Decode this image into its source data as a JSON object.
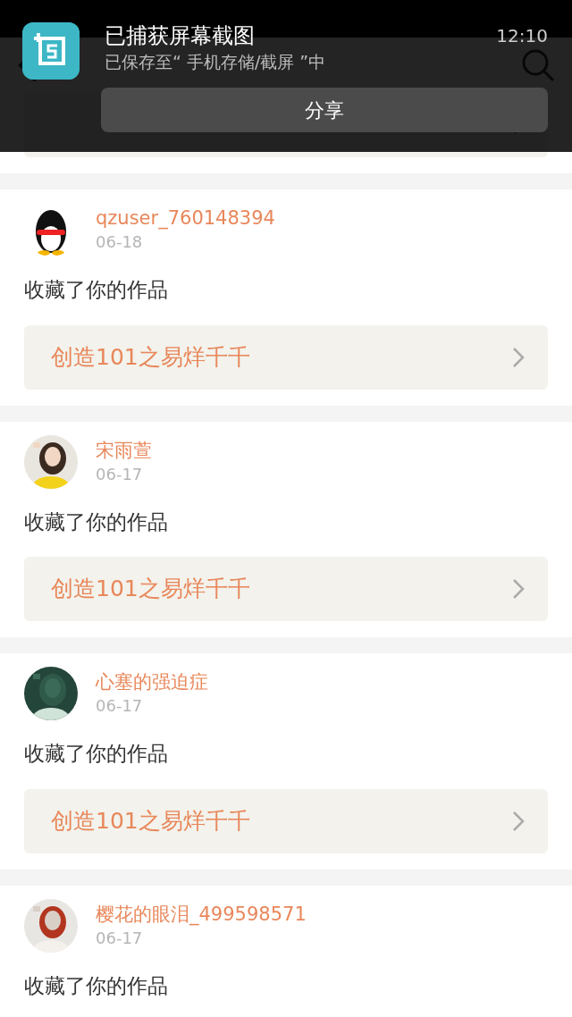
{
  "notification": {
    "title": "已捕获屏幕截图",
    "subtitle": "已保存至“ 手机存储/截屏 ”中",
    "time": "12:10",
    "action": "分享"
  },
  "messages": [
    {
      "user": "qzuser_760148394",
      "date": "06-18",
      "action": "收藏了你的作品",
      "link": "创造101之易烊千千",
      "avatar": {
        "kind": "icon"
      }
    },
    {
      "user": "宋雨萱",
      "date": "06-17",
      "action": "收藏了你的作品",
      "link": "创造101之易烊千千"
    },
    {
      "user": "心塞的强迫症",
      "date": "06-17",
      "action": "收藏了你的作品",
      "link": "创造101之易烊千千"
    },
    {
      "user": "樱花的眼泪_499598571",
      "date": "06-17",
      "action": "收藏了你的作品"
    }
  ]
}
